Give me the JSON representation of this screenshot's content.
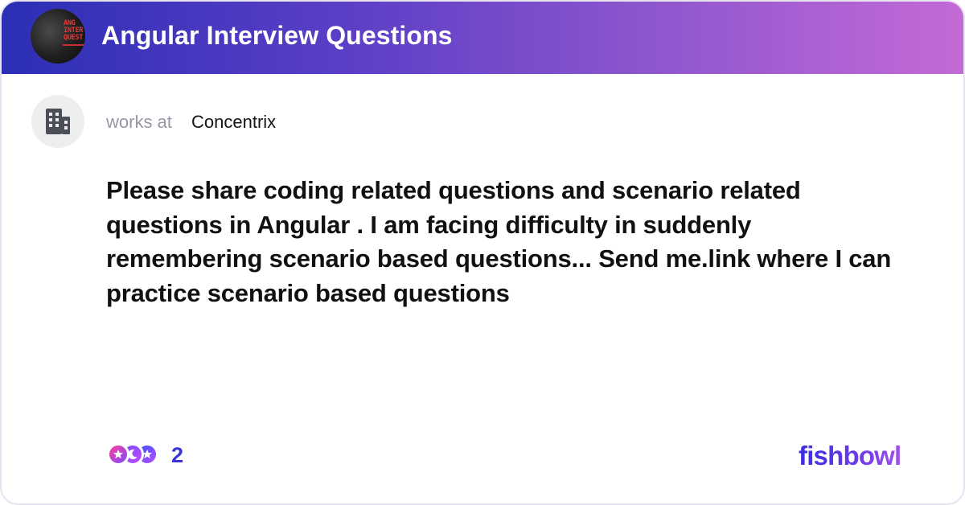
{
  "header": {
    "bowl_title": "Angular Interview Questions",
    "bowl_avatar_text": [
      "ANG",
      "INTER",
      "QUEST"
    ]
  },
  "author": {
    "works_at_label": "works at",
    "company": "Concentrix",
    "avatar_icon": "building-icon"
  },
  "post": {
    "text": "Please share coding related questions and scenario related questions in Angular . I am facing difficulty in suddenly remembering scenario based questions... Send me.link where I can practice scenario based questions"
  },
  "footer": {
    "reaction_icons": [
      "star-reaction-icon",
      "moon-reaction-icon",
      "star-reaction-icon"
    ],
    "reaction_count": "2",
    "logo": "fishbowl"
  },
  "colors": {
    "header_gradient_start": "#2b2fb5",
    "header_gradient_end": "#c46ad6",
    "accent": "#3b33d6",
    "border": "#e7e3f2"
  }
}
